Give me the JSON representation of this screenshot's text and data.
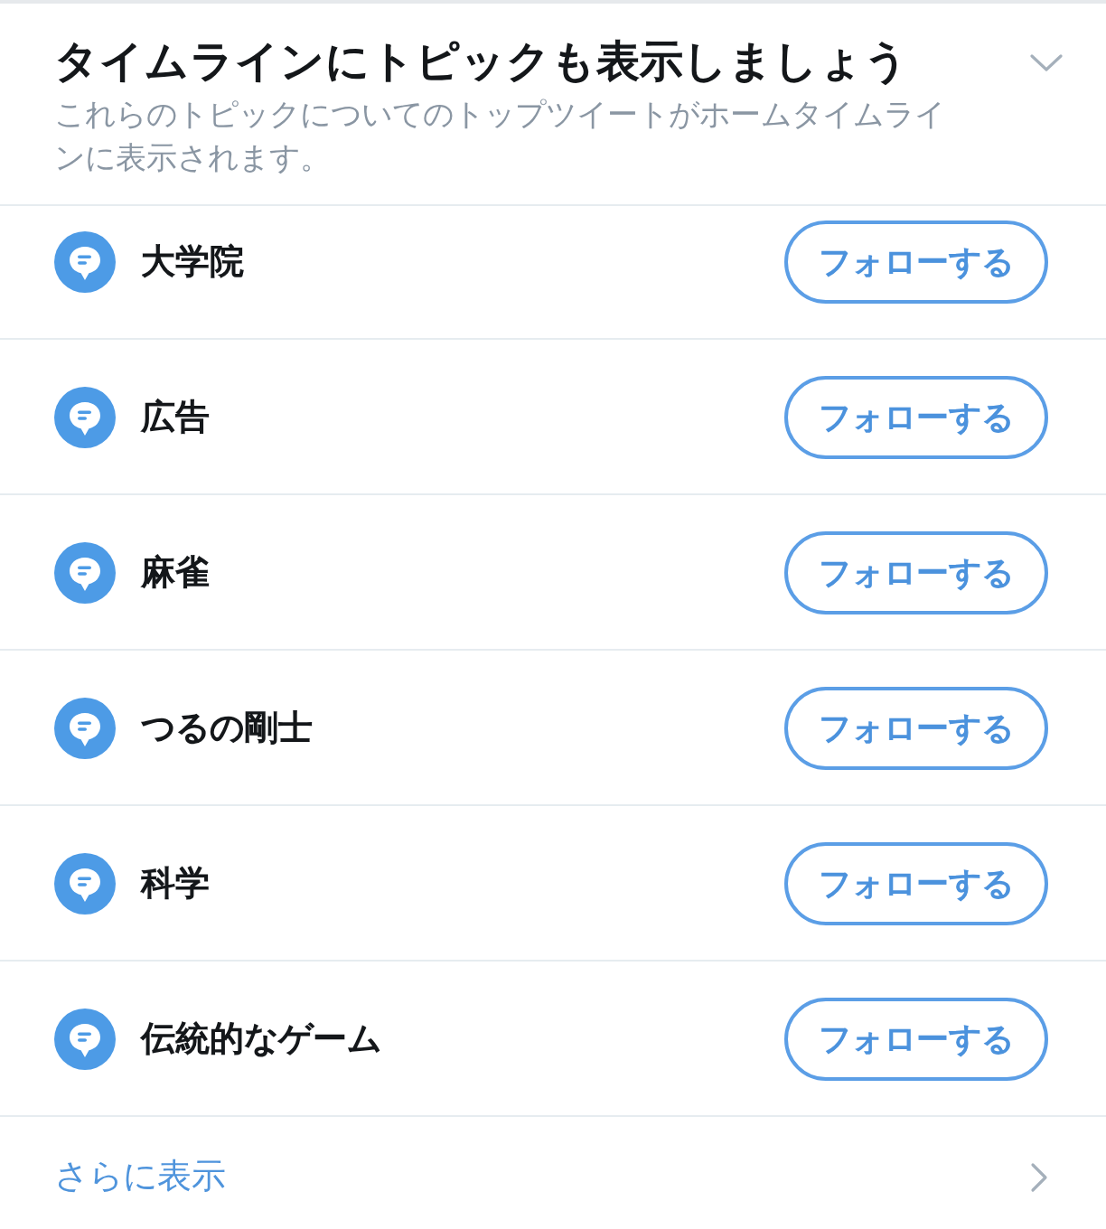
{
  "header": {
    "title": "タイムラインにトピックも表示しましょう",
    "subtitle": "これらのトピックについてのトップツイートがホームタイムラインに表示されます。"
  },
  "topics": [
    {
      "name": "大学院",
      "button": "フォローする"
    },
    {
      "name": "広告",
      "button": "フォローする"
    },
    {
      "name": "麻雀",
      "button": "フォローする"
    },
    {
      "name": "つるの剛士",
      "button": "フォローする"
    },
    {
      "name": "科学",
      "button": "フォローする"
    },
    {
      "name": "伝統的なゲーム",
      "button": "フォローする"
    }
  ],
  "show_more": {
    "label": "さらに表示"
  }
}
